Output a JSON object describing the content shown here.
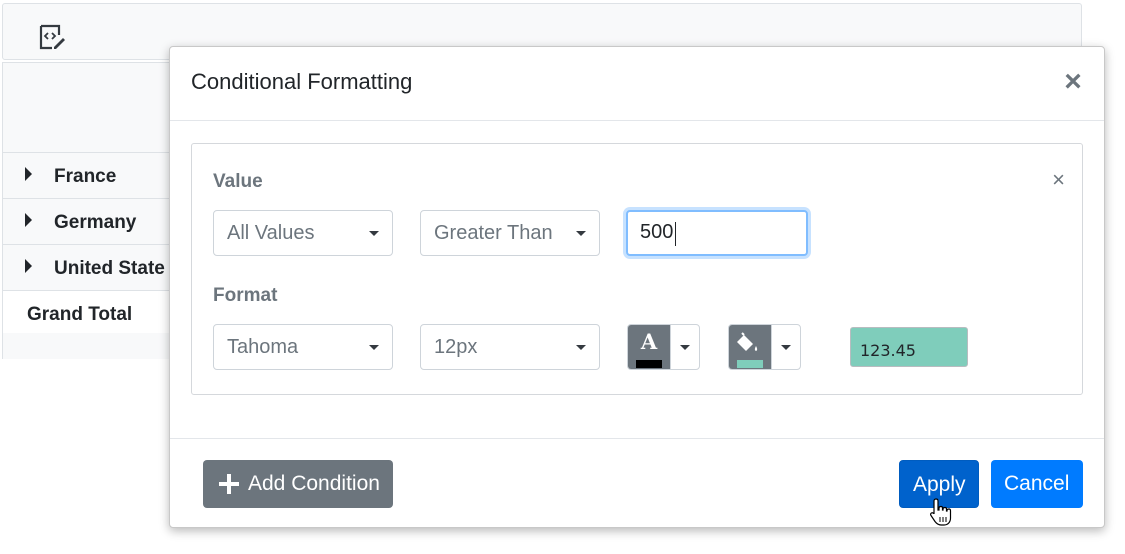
{
  "pivot": {
    "toolbar_icon": "code-edit-icon",
    "rows": [
      {
        "label": "France"
      },
      {
        "label": "Germany"
      },
      {
        "label": "United State"
      }
    ],
    "grand_total": "Grand Total"
  },
  "dialog": {
    "title": "Conditional Formatting",
    "close_label": "×",
    "condition": {
      "remove_label": "×",
      "value_label": "Value",
      "measure_select": "All Values",
      "operator_select": "Greater Than",
      "value_input": "500",
      "format_label": "Format",
      "font_select": "Tahoma",
      "size_select": "12px",
      "font_color": "#000000",
      "background_color": "#7fcdbb",
      "preview_text": "123.45"
    },
    "add_condition_label": "Add Condition",
    "apply_label": "Apply",
    "cancel_label": "Cancel"
  },
  "colors": {
    "primary": "#007bff",
    "secondary": "#6c757d",
    "focus": "#80bdff"
  }
}
